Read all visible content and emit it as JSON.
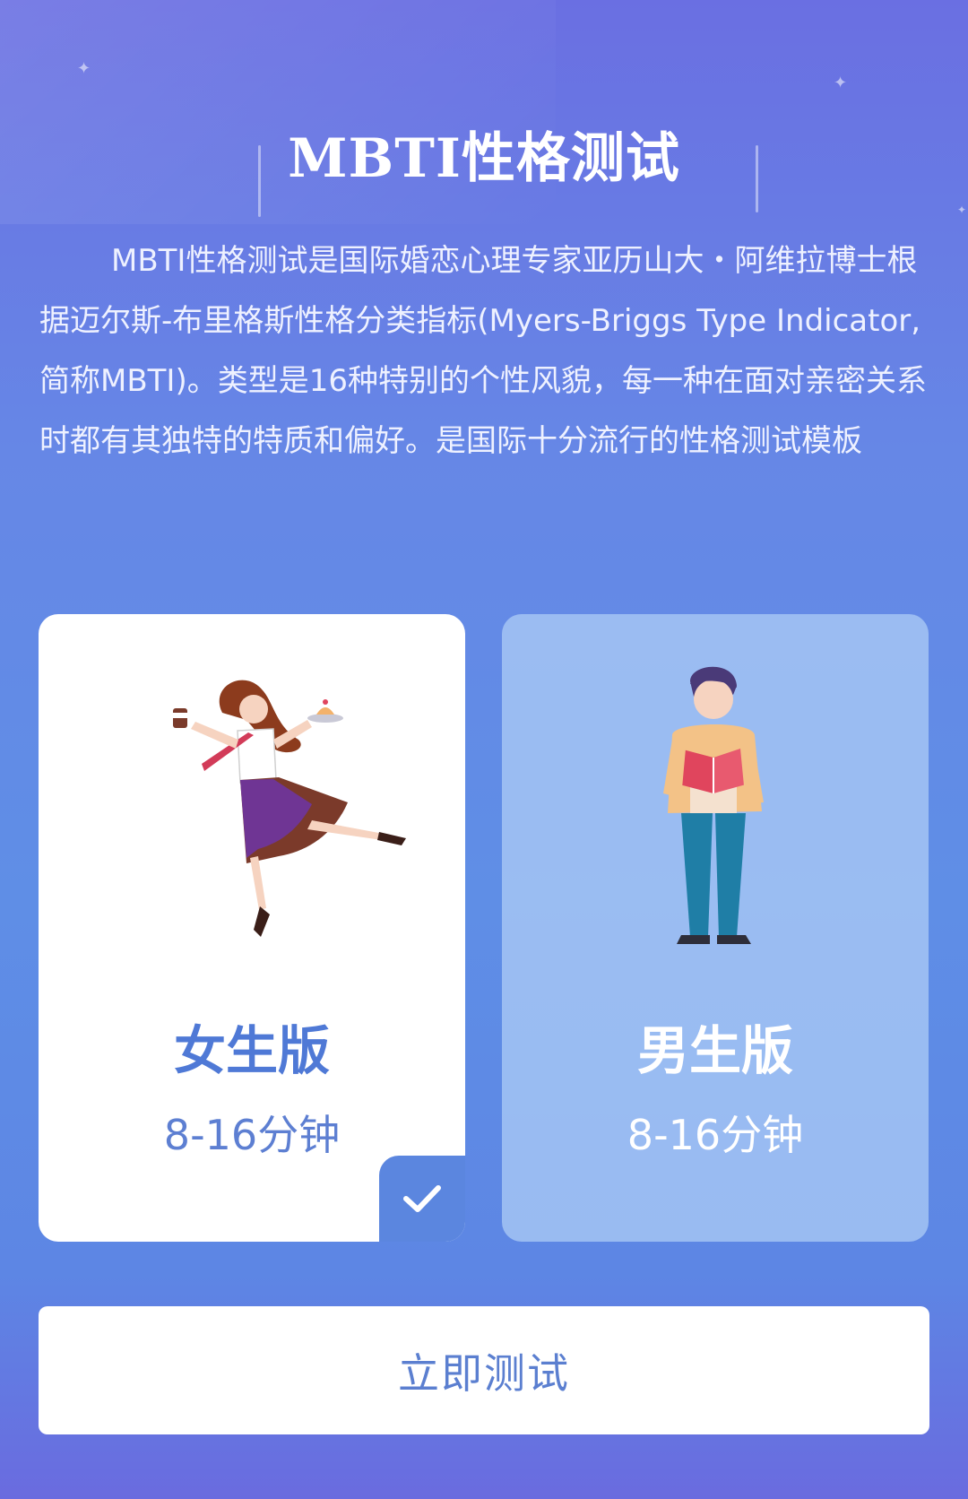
{
  "header": {
    "title": "MBTI性格测试"
  },
  "intro": {
    "text": "MBTI性格测试是国际婚恋心理专家亚历山大・阿维拉博士根据迈尔斯-布里格斯性格分类指标(Myers-Briggs Type Indicator,简称MBTI)。类型是16种特别的个性风貌，每一种在面对亲密关系时都有其独特的特质和偏好。是国际十分流行的性格测试模板"
  },
  "versions": [
    {
      "label": "女生版",
      "duration": "8-16分钟",
      "selected": true,
      "icon": "female-illustration"
    },
    {
      "label": "男生版",
      "duration": "8-16分钟",
      "selected": false,
      "icon": "male-illustration"
    }
  ],
  "action": {
    "start_label": "立即测试"
  },
  "colors": {
    "accent": "#5b86df",
    "background_top": "#6a6fe2",
    "background_bottom": "#6a6bdf",
    "selected_card": "#ffffff",
    "unselected_card": "#adccf5"
  }
}
